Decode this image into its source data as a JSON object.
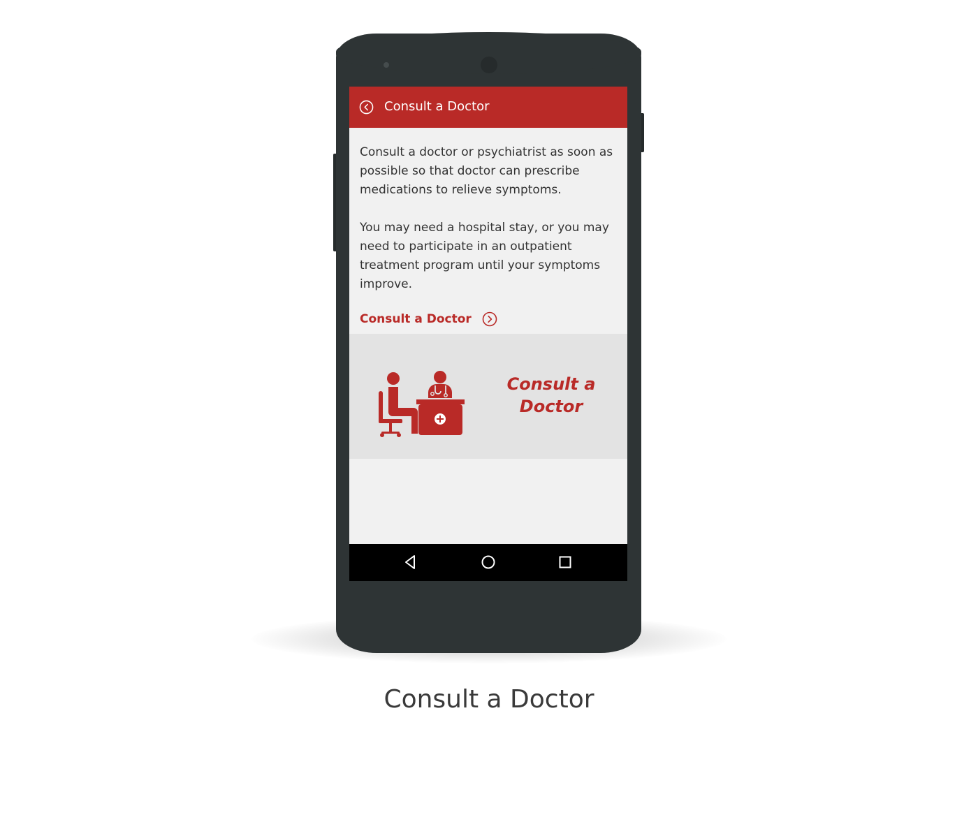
{
  "appbar": {
    "title": "Consult a Doctor",
    "back_icon": "chevron-left-circle-icon",
    "background": "#b92a27"
  },
  "content": {
    "paragraph_1": "Consult a doctor or psychiatrist as soon as possible so that doctor can prescribe medications to relieve symptoms.",
    "paragraph_2": "You may need a hospital stay, or you may need to participate in an outpatient treatment program until your symptoms improve.",
    "link_label": "Consult a Doctor",
    "link_icon": "chevron-right-circle-icon"
  },
  "banner": {
    "title": "Consult a Doctor",
    "illustration": "patient-doctor-desk-icon",
    "background": "#e3e3e3"
  },
  "navbar": {
    "back_icon": "triangle-back-icon",
    "home_icon": "circle-home-icon",
    "recent_icon": "square-recents-icon"
  },
  "caption": "Consult a Doctor",
  "colors": {
    "accent": "#b92a27",
    "device": "#2e3435",
    "text": "#333333"
  }
}
